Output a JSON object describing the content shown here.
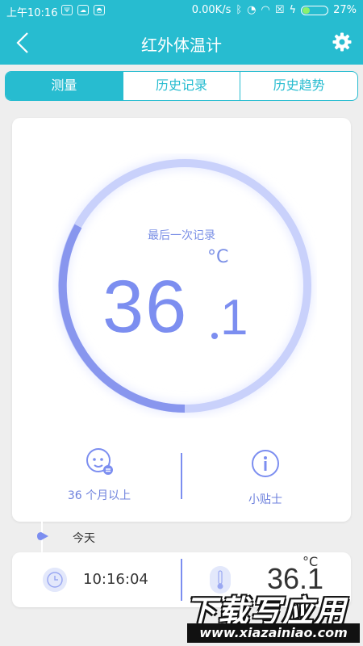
{
  "status_bar": {
    "time": "上午10:16",
    "network_speed": "0.00K/s",
    "battery": "27%",
    "battery_level": 0.27,
    "icons": [
      "usb-icon",
      "cloud-icon",
      "android-icon",
      "bluetooth-icon",
      "mute-icon",
      "wifi-icon",
      "sim-icon",
      "charging-icon"
    ]
  },
  "app_bar": {
    "title": "红外体温计",
    "back_icon": "back-icon",
    "settings_icon": "gear-icon"
  },
  "tabs": [
    {
      "label": "测量",
      "active": true
    },
    {
      "label": "历史记录",
      "active": false
    },
    {
      "label": "历史趋势",
      "active": false
    }
  ],
  "measurement": {
    "label": "最后一次记录",
    "unit": "°C",
    "temp_int": "36",
    "temp_dec": "1",
    "age_label": "36 个月以上",
    "tips_label": "小贴士"
  },
  "timeline": {
    "date_label": "今天"
  },
  "records": [
    {
      "time": "10:16:04",
      "temp": "36.1",
      "unit": "°C"
    }
  ],
  "watermark": {
    "top": "下载写应用",
    "bottom": "www.xiazainiao.com"
  },
  "colors": {
    "primary": "#27bcd0",
    "accent": "#7c8ef0",
    "background": "#eeeeee"
  }
}
